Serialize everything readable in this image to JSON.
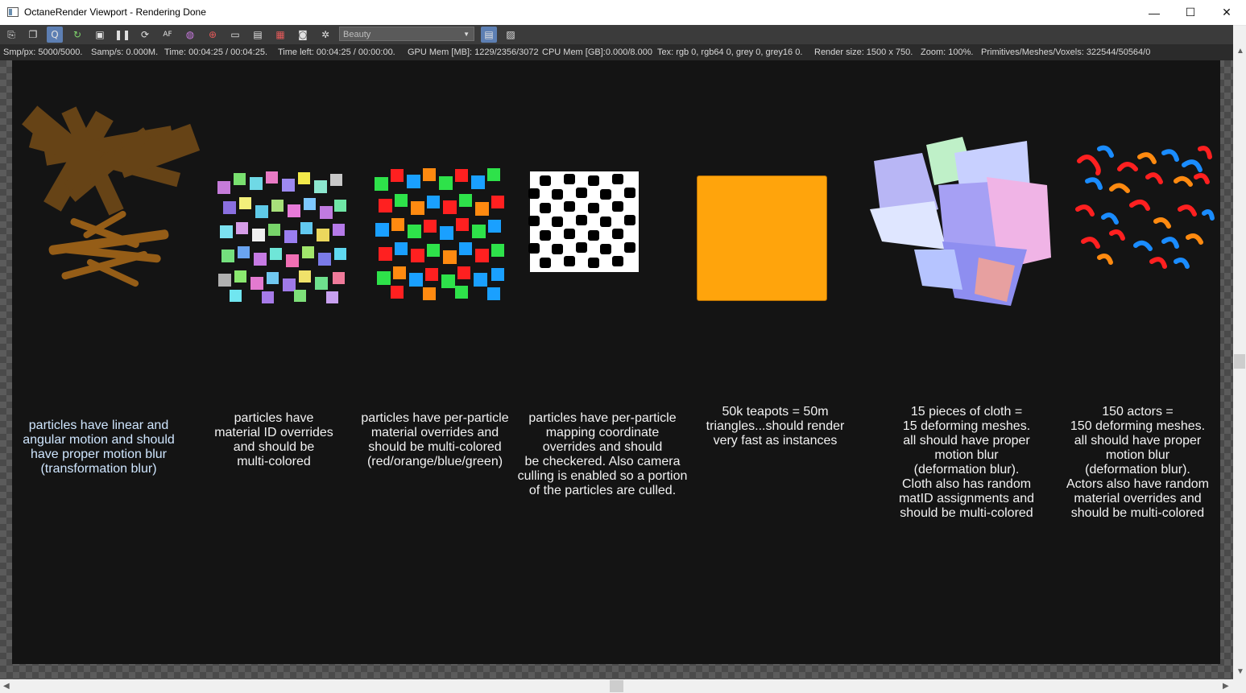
{
  "window": {
    "title": "OctaneRender Viewport - Rendering Done",
    "controls": {
      "minimize": "—",
      "maximize": "☐",
      "close": "✕"
    }
  },
  "toolbar": {
    "icons": [
      "export-icon",
      "copy-icon",
      "quick-q-icon",
      "refresh-icon",
      "lock-icon",
      "pause-icon",
      "restart-icon",
      "af-icon",
      "color-wheel-icon",
      "life-ring-icon",
      "monitor-icon",
      "film-icon",
      "region-icon",
      "camera-icon",
      "settings-icon"
    ],
    "render_pass_select": {
      "value": "Beauty"
    },
    "right_icons": [
      "table-view-icon",
      "image-icon"
    ]
  },
  "status": {
    "smp_px": "Smp/px: 5000/5000.",
    "samp_s": "Samp/s: 0.000M.",
    "time": "Time: 00:04:25 / 00:04:25.",
    "time_left": "Time left: 00:04:25 / 00:00:00.",
    "gpu_mem": "GPU Mem [MB]: 1229/2356/3072",
    "cpu_mem": "CPU Mem [GB]:0.000/8.000",
    "tex": "Tex: rgb 0, rgb64 0, grey 0, grey16 0.",
    "render_size": "Render size: 1500 x 750.",
    "zoom": "Zoom: 100%.",
    "primitives": "Primitives/Meshes/Voxels: 322544/50564/0"
  },
  "captions": [
    "particles have linear and\nangular motion and should\nhave proper motion blur\n(transformation blur)",
    "particles have\nmaterial ID overrides\nand should be\nmulti-colored",
    "particles have per-particle\nmaterial overrides and\nshould be multi-colored\n(red/orange/blue/green)",
    "particles have per-particle\nmapping coordinate\noverrides and should\nbe checkered. Also camera\nculling is enabled so a portion\nof the particles are culled.",
    "50k teapots = 50m\ntriangles...should render\nvery fast as instances",
    "15 pieces of cloth =\n15 deforming meshes.\nall should have proper\nmotion blur\n(deformation blur).\nCloth also has random\nmatID assignments and\nshould be multi-colored",
    "150 actors =\n150 deforming meshes.\nall should have proper\nmotion blur\n(deformation blur).\nActors also have random\nmaterial overrides and\nshould be multi-colored"
  ],
  "colors": {
    "orange": "#ff9a1a",
    "teapot_orange": "#ffa40c",
    "caption_blue": "#cfe6ff",
    "render_bg": "#141414"
  }
}
